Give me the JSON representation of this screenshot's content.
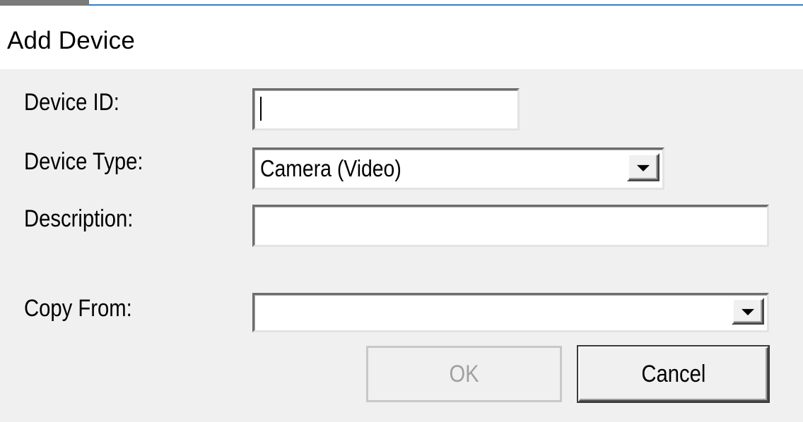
{
  "dialog": {
    "title": "Add Device"
  },
  "form": {
    "device_id": {
      "label": "Device ID:",
      "value": ""
    },
    "device_type": {
      "label": "Device Type:",
      "selected": "Camera (Video)"
    },
    "description": {
      "label": "Description:",
      "value": ""
    },
    "copy_from": {
      "label": "Copy From:",
      "selected": ""
    }
  },
  "buttons": {
    "ok_label": "OK",
    "ok_enabled": false,
    "cancel_label": "Cancel"
  },
  "icons": {
    "dropdown": "chevron-down-icon"
  },
  "colors": {
    "accent_line": "#2a7fd0",
    "body_bg": "#f0f0f0",
    "disabled_text": "#a0a0a0"
  }
}
